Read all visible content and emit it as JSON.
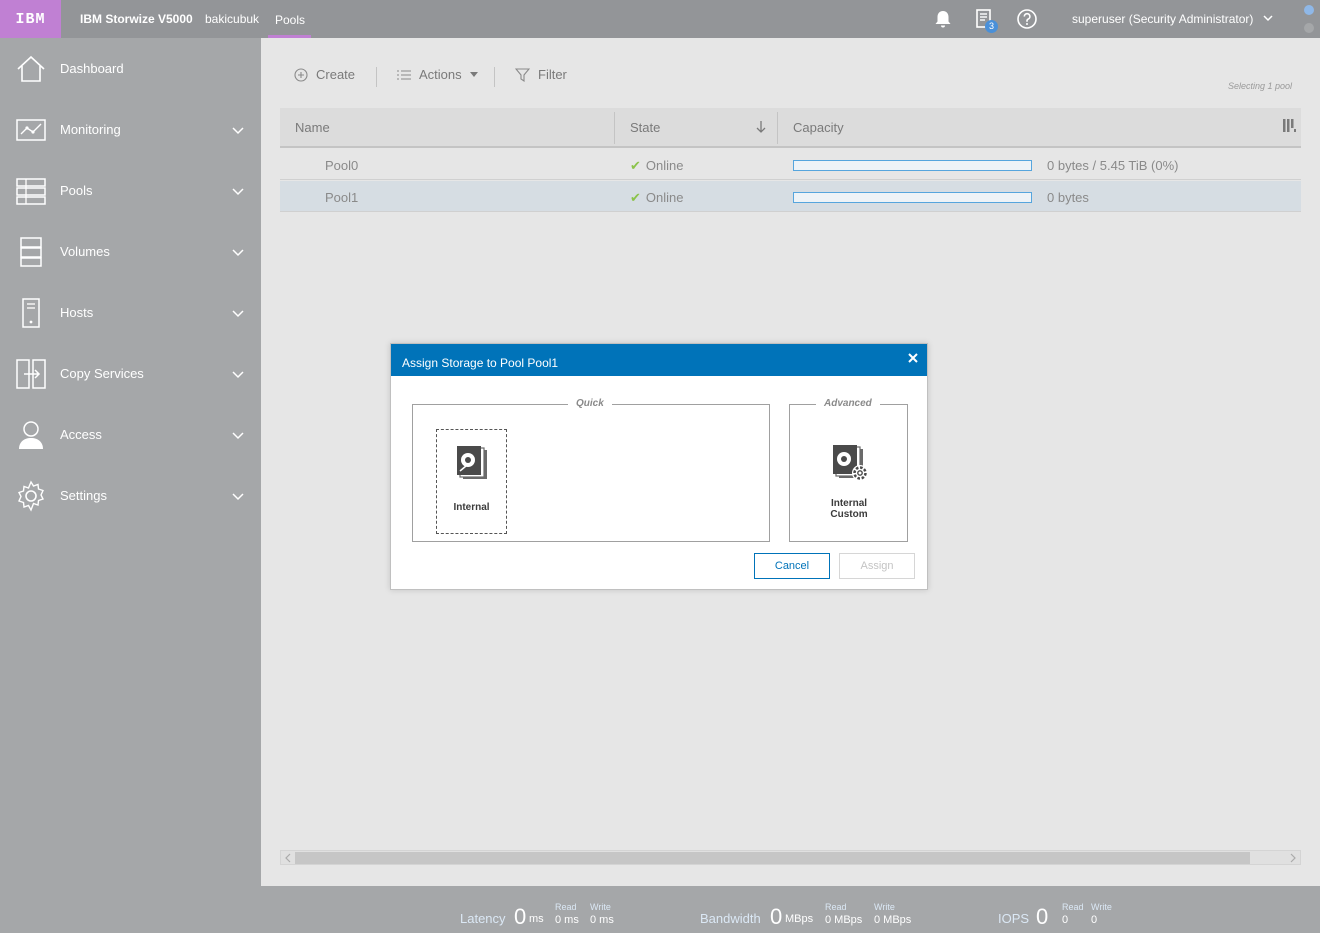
{
  "topbar": {
    "logo": "IBM",
    "app_name": "IBM Storwize V5000",
    "breadcrumb": [
      "bakicubuk",
      "Pools"
    ],
    "tasks_badge": "3",
    "user": "superuser (Security Administrator)"
  },
  "sidebar": {
    "items": [
      {
        "label": "Dashboard",
        "icon": "home-icon"
      },
      {
        "label": "Monitoring",
        "icon": "monitoring-icon"
      },
      {
        "label": "Pools",
        "icon": "pools-icon"
      },
      {
        "label": "Volumes",
        "icon": "volumes-icon"
      },
      {
        "label": "Hosts",
        "icon": "hosts-icon"
      },
      {
        "label": "Copy Services",
        "icon": "copy-services-icon"
      },
      {
        "label": "Access",
        "icon": "access-icon"
      },
      {
        "label": "Settings",
        "icon": "settings-icon"
      }
    ]
  },
  "toolbar": {
    "create": "Create",
    "actions": "Actions",
    "filter": "Filter",
    "selecting": "Selecting 1 pool"
  },
  "table": {
    "columns": [
      "Name",
      "State",
      "Capacity"
    ],
    "rows": [
      {
        "name": "Pool0",
        "state": "Online",
        "capacity": "0 bytes / 5.45 TiB (0%)",
        "used_percent": 0
      },
      {
        "name": "Pool1",
        "state": "Online",
        "capacity": "0 bytes",
        "used_percent": 0
      }
    ]
  },
  "dialog": {
    "title": "Assign Storage to Pool Pool1",
    "quick_legend": "Quick",
    "advanced_legend": "Advanced",
    "internal": "Internal",
    "internal_custom_1": "Internal",
    "internal_custom_2": "Custom",
    "cancel": "Cancel",
    "assign": "Assign"
  },
  "footer": {
    "latency_label": "Latency",
    "latency_value": "0",
    "latency_unit": "ms",
    "latency_read": "0 ms",
    "latency_write": "0 ms",
    "bandwidth_label": "Bandwidth",
    "bandwidth_value": "0",
    "bandwidth_unit": "MBps",
    "bandwidth_read": "0 MBps",
    "bandwidth_write": "0 MBps",
    "iops_label": "IOPS",
    "iops_value": "0",
    "iops_read": "0",
    "iops_write": "0",
    "read_label": "Read",
    "write_label": "Write"
  },
  "colors": {
    "brand": "#c080d3",
    "dialog_header": "#0073b9",
    "capacity_bar": "#56a5dd",
    "online_check": "#8bc34a"
  }
}
